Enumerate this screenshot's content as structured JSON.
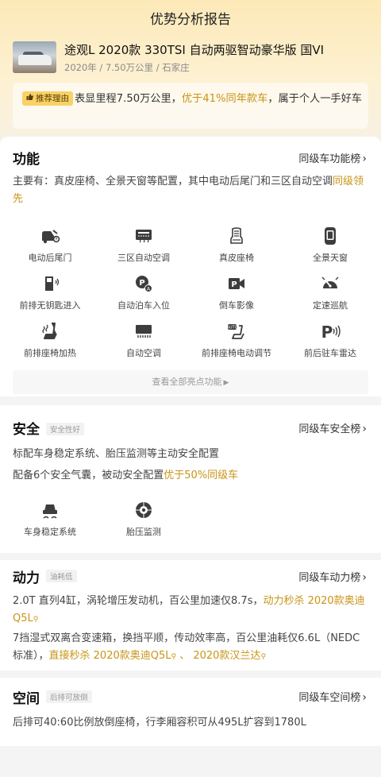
{
  "header": {
    "title": "优势分析报告"
  },
  "car": {
    "name": "途观L 2020款 330TSI 自动两驱智动豪华版 国VI",
    "meta": "2020年 / 7.50万公里 / 石家庄"
  },
  "reason": {
    "tag": "推荐理由",
    "text_a": "表显里程7.50万公里，",
    "text_hl": "优于41%同年款车",
    "text_b": "，属于个人一手好车"
  },
  "features": {
    "title": "功能",
    "rank": "同级车功能榜",
    "desc_a": "主要有：真皮座椅、全景天窗等配置，其中电动后尾门和三区自动空调",
    "desc_hl": "同级领先",
    "items": [
      {
        "label": "电动后尾门",
        "icon": "power-tailgate-icon"
      },
      {
        "label": "三区自动空调",
        "icon": "auto-ac-three-zone-icon"
      },
      {
        "label": "真皮座椅",
        "icon": "leather-seat-icon"
      },
      {
        "label": "全景天窗",
        "icon": "panoramic-sunroof-icon"
      },
      {
        "label": "前排无钥匙进入",
        "icon": "keyless-entry-icon"
      },
      {
        "label": "自动泊车入位",
        "icon": "auto-parking-icon"
      },
      {
        "label": "倒车影像",
        "icon": "reverse-camera-icon"
      },
      {
        "label": "定速巡航",
        "icon": "cruise-control-icon"
      },
      {
        "label": "前排座椅加热",
        "icon": "seat-heating-icon"
      },
      {
        "label": "自动空调",
        "icon": "auto-ac-icon"
      },
      {
        "label": "前排座椅电动调节",
        "icon": "power-seat-icon"
      },
      {
        "label": "前后驻车雷达",
        "icon": "parking-radar-icon"
      }
    ],
    "all_button": "查看全部亮点功能"
  },
  "safety": {
    "title": "安全",
    "badge": "安全性好",
    "rank": "同级车安全榜",
    "line1": "标配车身稳定系统、胎压监测等主动安全配置",
    "line2_a": "配备6个安全气囊，被动安全配置",
    "line2_hl": "优于50%同级车",
    "items": [
      {
        "label": "车身稳定系统",
        "icon": "stability-control-icon"
      },
      {
        "label": "胎压监测",
        "icon": "tire-pressure-icon"
      }
    ]
  },
  "power": {
    "title": "动力",
    "badge": "油耗低",
    "rank": "同级车动力榜",
    "line1_a": "2.0T 直列4缸，涡轮增压发动机，百公里加速仅8.7s，",
    "line1_hl": "动力秒杀 2020款奥迪Q5L",
    "line2_a": "7挡湿式双离合变速箱，换挡平顺，传动效率高，百公里油耗仅6.6L（NEDC标准），",
    "line2_hl1": "直接秒杀 2020款奥迪Q5L",
    "line2_sep": " 、 ",
    "line2_hl2": "2020款汉兰达"
  },
  "space": {
    "title": "空间",
    "badge": "后排可放倒",
    "rank": "同级车空间榜",
    "line1": "后排可40:60比例放倒座椅，行李厢容积可从495L扩容到1780L"
  },
  "colors": {
    "accent": "#c99417",
    "tag_bg": "#f8d267",
    "header_gradient_top": "#fde9b8"
  }
}
